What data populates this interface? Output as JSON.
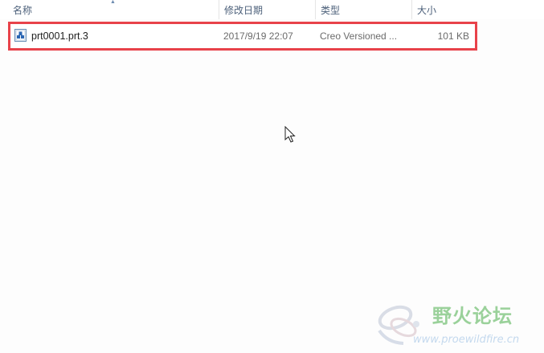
{
  "columns": {
    "name": "名称",
    "date_modified": "修改日期",
    "type": "类型",
    "size": "大小"
  },
  "sort": {
    "column": "name",
    "direction": "ascending",
    "icon": "sort-up-arrow-icon"
  },
  "files": [
    {
      "name": "prt0001.prt.3",
      "date_modified": "2017/9/19 22:07",
      "type": "Creo Versioned ...",
      "size": "101 KB",
      "icon": "creo-part-file-icon",
      "highlighted": true
    }
  ],
  "watermark": {
    "title": "野火论坛",
    "url": "www.proewildfire.cn"
  },
  "colors": {
    "highlight_border": "#e8424a",
    "header_text": "#4c607a",
    "watermark_green": "#9ad19a",
    "watermark_blue": "#c4d9ee"
  }
}
